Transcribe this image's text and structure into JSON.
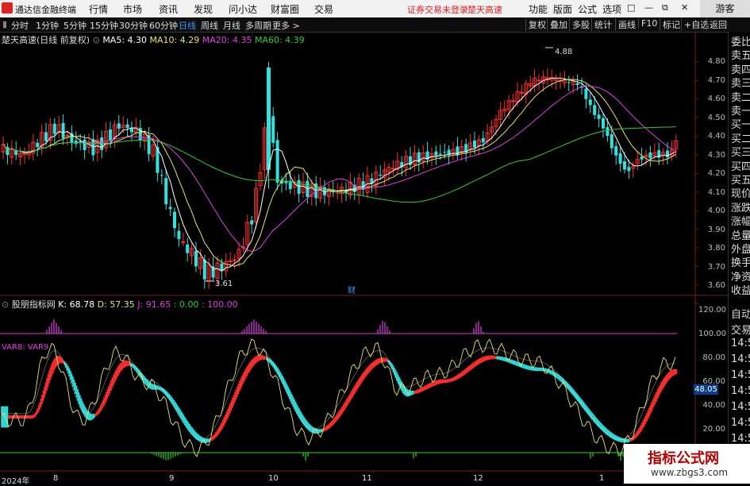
{
  "menu": {
    "brand": "通达信金融终端",
    "items": [
      "行情",
      "市场",
      "资讯",
      "发现",
      "问小达",
      "财富圈",
      "交易"
    ],
    "notice": "证券交易未登录",
    "stock_name": "楚天高速",
    "right_items": [
      "功能",
      "版面",
      "公式",
      "选项"
    ],
    "window_controls": [
      "□",
      "—",
      "⧉",
      "✕"
    ],
    "user_button": "游客"
  },
  "period_bar": {
    "periods": [
      "分时",
      "1分钟",
      "5分钟",
      "15分钟",
      "30分钟",
      "60分钟",
      "日线",
      "周线",
      "月线",
      "多周期",
      "更多 >"
    ],
    "active": "日线",
    "right_buttons": [
      "复权",
      "叠加",
      "多股",
      "统计",
      "画线",
      "F10",
      "标记",
      "+自选",
      "返回"
    ]
  },
  "main_chart": {
    "title": "楚天高速(日线 前复权)",
    "ma_labels": [
      {
        "text": "MA5: 4.30",
        "color": "#ffffff"
      },
      {
        "text": "MA10: 4.29",
        "color": "#e8e26a"
      },
      {
        "text": "MA20: 4.35",
        "color": "#e040e0"
      },
      {
        "text": "MA60: 4.39",
        "color": "#33cc33"
      }
    ],
    "y_ticks": [
      "4.88",
      "4.80",
      "4.70",
      "4.60",
      "4.50",
      "4.40",
      "4.30",
      "4.20",
      "4.10",
      "4.00",
      "3.90",
      "3.80",
      "3.70",
      "3.60"
    ],
    "high_label": "4.88",
    "low_label": "3.61",
    "event_mark": "财"
  },
  "indicator": {
    "title": "股朋指标网",
    "values": [
      {
        "text": "K: 68.78",
        "color": "#ffffff"
      },
      {
        "text": "D: 57.35",
        "color": "#e8e26a"
      },
      {
        "text": "J: 91.65",
        "color": "#e040e0"
      },
      {
        "text": ": 0.00",
        "color": "#33cc33"
      },
      {
        "text": ": 100.00",
        "color": "#e040e0"
      }
    ],
    "var_label": "VAR8:  VAR9",
    "y_ticks": [
      "120.00",
      "100.00",
      "80.00",
      "60.00",
      "40.00",
      "20.00"
    ],
    "current_value": "48.05"
  },
  "x_axis": [
    "2024年",
    "8",
    "9",
    "10",
    "11",
    "12",
    "1"
  ],
  "right_panel": {
    "items": [
      "委比",
      "卖五",
      "卖四",
      "卖三",
      "卖二",
      "卖一",
      "买一",
      "买二",
      "买三",
      "买四",
      "买五",
      "现价",
      "涨跌",
      "涨幅",
      "总量",
      "外盘",
      "换手",
      "净资",
      "收益"
    ],
    "lower_items": [
      "自动",
      "交易",
      "14:5",
      "14:5",
      "14:5",
      "14:5",
      "14:5",
      "14:5",
      "14:5",
      "14:5",
      "14:5"
    ]
  },
  "watermark": {
    "title": "指标公式网",
    "url": "www.zbgs3.com"
  },
  "colors": {
    "up": "#ff3030",
    "down": "#33e0e0",
    "ma5": "#ffffff",
    "ma10": "#e8e26a",
    "ma20": "#e040e0",
    "ma60": "#33cc33"
  }
}
